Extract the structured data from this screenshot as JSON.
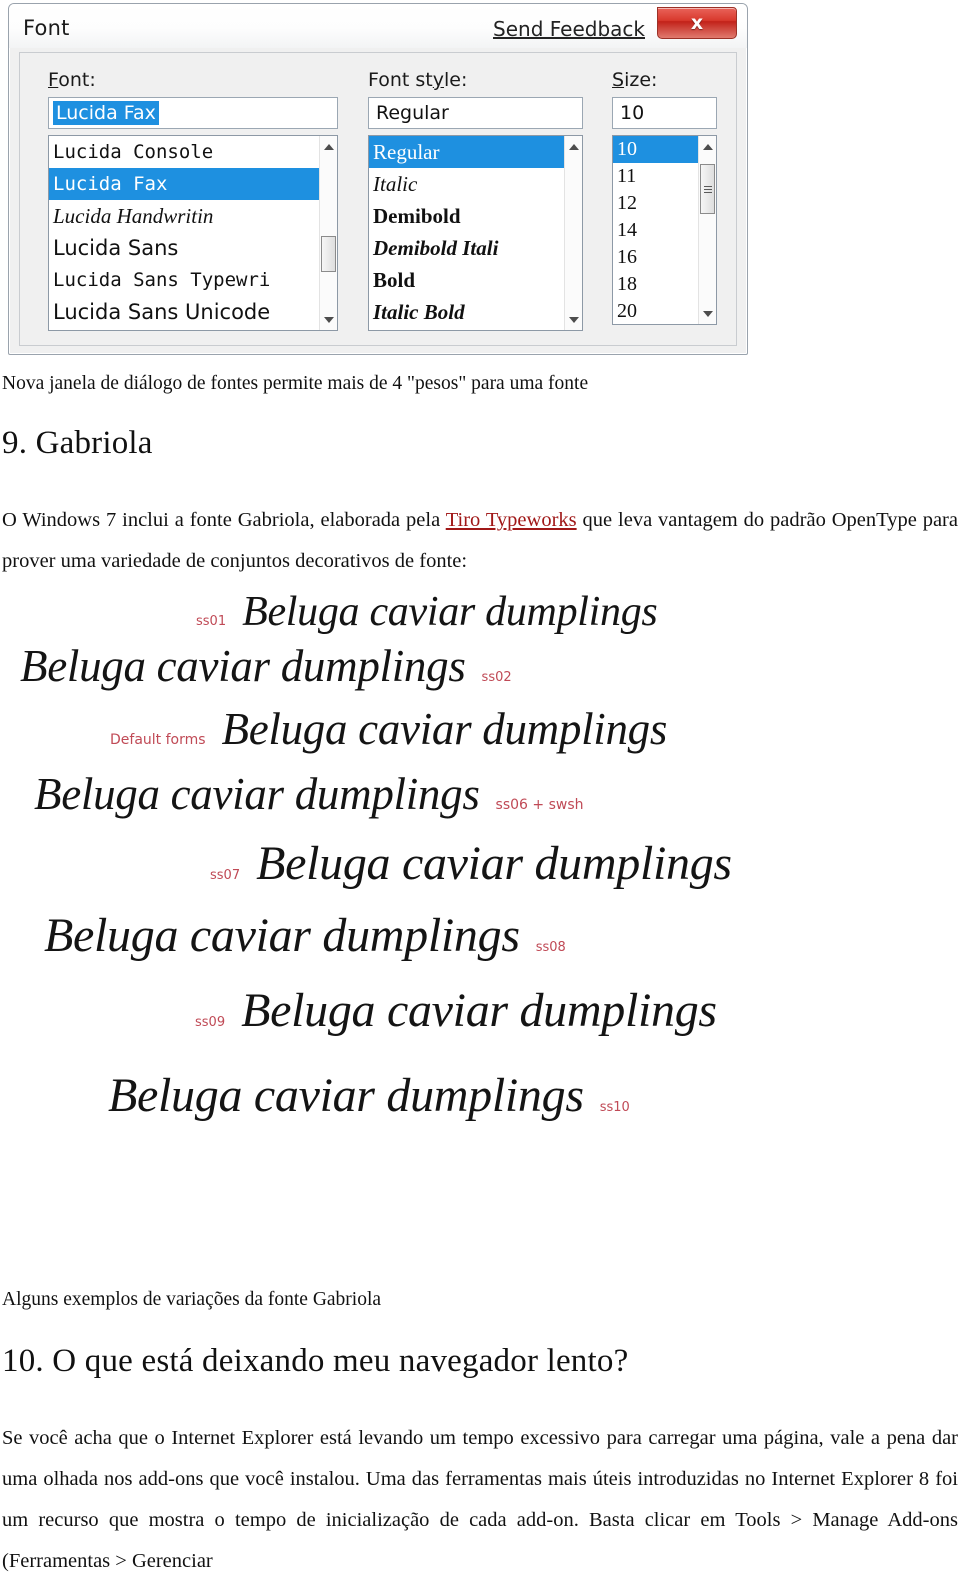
{
  "dialog": {
    "title": "Font",
    "send_feedback": "Send Feedback",
    "close_glyph": "x",
    "font": {
      "label_prefix": "F",
      "label_rest": "ont:",
      "value": "Lucida Fax",
      "items": [
        "Lucida Console",
        "Lucida Fax",
        "Lucida Handwritin",
        "Lucida Sans",
        "Lucida Sans Typewri",
        "Lucida Sans Unicode"
      ],
      "selected_index": 1
    },
    "style": {
      "label_pre": "Font st",
      "label_mid": "y",
      "label_post": "le:",
      "value": "Regular",
      "items": [
        "Regular",
        "Italic",
        "Demibold",
        "Demibold Itali",
        "Bold",
        "Italic Bold"
      ],
      "selected_index": 0
    },
    "size": {
      "label_prefix": "S",
      "label_rest": "ize:",
      "value": "10",
      "items": [
        "10",
        "11",
        "12",
        "14",
        "16",
        "18",
        "20"
      ],
      "selected_index": 0
    }
  },
  "doc": {
    "caption_dialog": "Nova janela de diálogo de fontes permite mais de 4 \"pesos\" para uma fonte",
    "heading_gabriola": "9. Gabriola",
    "para_gabriola_a": "O Windows 7 inclui a fonte Gabriola, elaborada pela ",
    "para_gabriola_link": "Tiro Typeworks",
    "para_gabriola_b": " que leva vantagem do padrão OpenType para prover uma variedade de conjuntos decorativos de fonte:",
    "caption_gabriola": "Alguns exemplos de variações da fonte Gabriola",
    "heading_browser": "10. O que está deixando meu navegador lento?",
    "para_browser": "Se você acha que o Internet Explorer está levando um tempo excessivo para carregar uma página, vale a pena dar uma olhada nos add-ons que você instalou. Uma das ferramentas mais úteis introduzidas no Internet Explorer 8 foi um recurso que mostra o tempo de inicialização de cada add-on. Basta clicar em Tools > Manage Add-ons (Ferramentas > Gerenciar"
  },
  "gabriola_figure": {
    "sample_text": "Beluga caviar dumplings",
    "rows": [
      {
        "tag": "ss01",
        "tag_side": "left"
      },
      {
        "tag": "ss02",
        "tag_side": "right"
      },
      {
        "tag": "Default forms",
        "tag_side": "left"
      },
      {
        "tag": "ss06 + swsh",
        "tag_side": "right"
      },
      {
        "tag": "ss07",
        "tag_side": "left"
      },
      {
        "tag": "ss08",
        "tag_side": "right"
      },
      {
        "tag": "ss09",
        "tag_side": "left"
      },
      {
        "tag": "ss10",
        "tag_side": "right"
      }
    ]
  },
  "colors": {
    "selection_blue": "#1e90e0",
    "link_red": "#a01818",
    "tag_red": "#c04a56",
    "close_red": "#d8382c"
  }
}
